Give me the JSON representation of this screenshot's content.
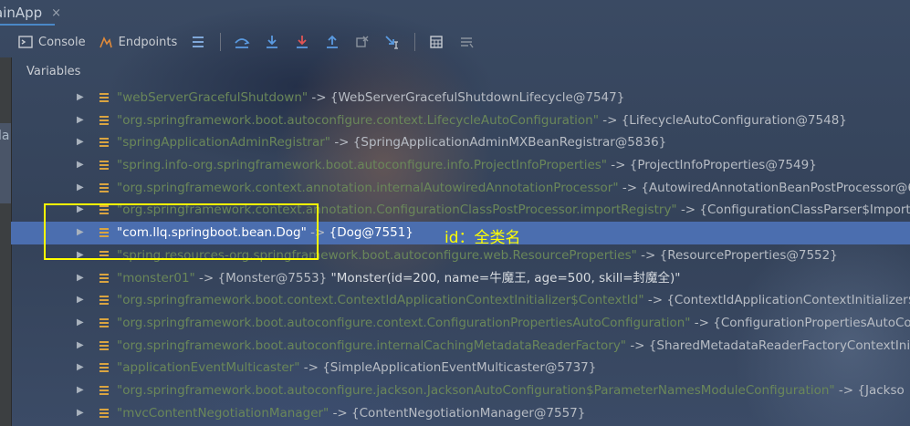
{
  "app": {
    "tab_title": "ainApp",
    "tab_close": "×",
    "side_text": "la"
  },
  "toolbar": {
    "console_label": "Console",
    "endpoints_label": "Endpoints"
  },
  "variables": {
    "header": "Variables"
  },
  "rows": [
    {
      "key": "\"webServerGracefulShutdown\"",
      "arrow": "->",
      "value": "{WebServerGracefulShutdownLifecycle@7547}",
      "extra": ""
    },
    {
      "key": "\"org.springframework.boot.autoconfigure.context.LifecycleAutoConfiguration\"",
      "arrow": "->",
      "value": "{LifecycleAutoConfiguration@7548}",
      "extra": ""
    },
    {
      "key": "\"springApplicationAdminRegistrar\"",
      "arrow": "->",
      "value": "{SpringApplicationAdminMXBeanRegistrar@5836}",
      "extra": ""
    },
    {
      "key": "\"spring.info-org.springframework.boot.autoconfigure.info.ProjectInfoProperties\"",
      "arrow": "->",
      "value": "{ProjectInfoProperties@7549}",
      "extra": ""
    },
    {
      "key": "\"org.springframework.context.annotation.internalAutowiredAnnotationProcessor\"",
      "arrow": "->",
      "value": "{AutowiredAnnotationBeanPostProcessor@6",
      "extra": ""
    },
    {
      "key": "\"org.springframework.context.annotation.ConfigurationClassPostProcessor.importRegistry\"",
      "arrow": "->",
      "value": "{ConfigurationClassParser$ImportSt",
      "extra": ""
    },
    {
      "key": "\"com.llq.springboot.bean.Dog\"",
      "arrow": "->",
      "value": "{Dog@7551}",
      "extra": ""
    },
    {
      "key": "\"spring.resources-org.springframework.boot.autoconfigure.web.ResourceProperties\"",
      "arrow": "->",
      "value": "{ResourceProperties@7552}",
      "extra": ""
    },
    {
      "key": "\"monster01\"",
      "arrow": "->",
      "value": "{Monster@7553}",
      "extra": "\"Monster(id=200, name=牛魔王, age=500, skill=封魔全)\""
    },
    {
      "key": "\"org.springframework.boot.context.ContextIdApplicationContextInitializer$ContextId\"",
      "arrow": "->",
      "value": "{ContextIdApplicationContextInitializer$C",
      "extra": ""
    },
    {
      "key": "\"org.springframework.boot.autoconfigure.context.ConfigurationPropertiesAutoConfiguration\"",
      "arrow": "->",
      "value": "{ConfigurationPropertiesAutoCo",
      "extra": ""
    },
    {
      "key": "\"org.springframework.boot.autoconfigure.internalCachingMetadataReaderFactory\"",
      "arrow": "->",
      "value": "{SharedMetadataReaderFactoryContextIniti",
      "extra": ""
    },
    {
      "key": "\"applicationEventMulticaster\"",
      "arrow": "->",
      "value": "{SimpleApplicationEventMulticaster@5737}",
      "extra": ""
    },
    {
      "key": "\"org.springframework.boot.autoconfigure.jackson.JacksonAutoConfiguration$ParameterNamesModuleConfiguration\"",
      "arrow": "->",
      "value": "{Jackso",
      "extra": ""
    },
    {
      "key": "\"mvcContentNegotiationManager\"",
      "arrow": "->",
      "value": "{ContentNegotiationManager@7557}",
      "extra": ""
    }
  ],
  "annotation": {
    "text": "id：全类名"
  },
  "icons": [
    "console-icon",
    "endpoints-icon",
    "restore-layout-icon",
    "step-over-icon",
    "step-into-icon",
    "force-step-into-icon",
    "step-out-icon",
    "drop-frame-icon",
    "run-to-cursor-icon",
    "evaluate-expression-icon",
    "trace-icon",
    "expand-arrow-icon",
    "field-icon"
  ],
  "colors": {
    "key_green": "#6a8759",
    "selected_row": "#4b6eaf",
    "annotation_yellow": "#ffff00"
  }
}
